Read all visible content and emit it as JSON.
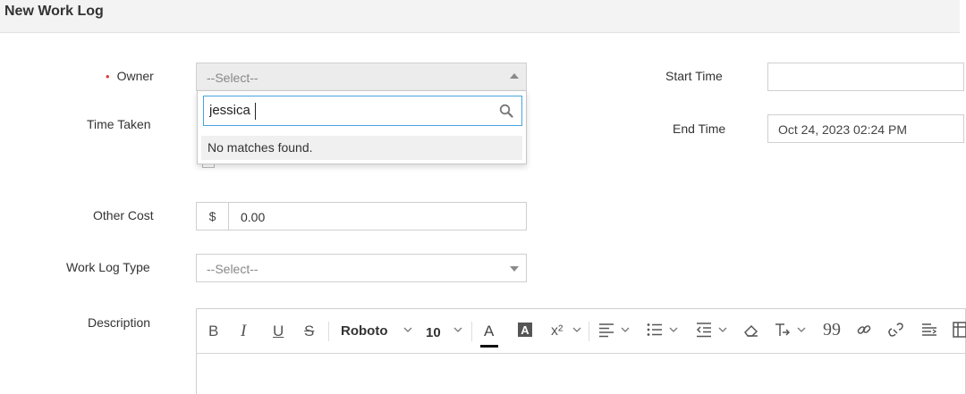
{
  "header": {
    "title": "New Work Log"
  },
  "form": {
    "owner": {
      "label": "Owner",
      "required_mark": "•",
      "placeholder": "--Select--"
    },
    "owner_dropdown": {
      "search_value": "jessica",
      "no_matches": "No matches found."
    },
    "time_taken": {
      "label": "Time Taken"
    },
    "other_cost": {
      "label": "Other Cost",
      "currency": "$",
      "value": "0.00"
    },
    "work_log_type": {
      "label": "Work Log Type",
      "placeholder": "--Select--"
    },
    "description": {
      "label": "Description"
    },
    "start_time": {
      "label": "Start Time",
      "value": ""
    },
    "end_time": {
      "label": "End Time",
      "value": "Oct 24, 2023 02:24 PM"
    }
  },
  "editor_toolbar": {
    "bold": "B",
    "italic": "I",
    "underline": "U",
    "strike": "S",
    "font_family": "Roboto",
    "font_size": "10",
    "font_color": "A",
    "superscript": "x²"
  },
  "icons": [
    "search-icon",
    "chevron-down-icon",
    "chevron-up-icon",
    "align-icon",
    "bullet-list-icon",
    "outdent-icon",
    "eraser-icon",
    "text-direction-icon",
    "quote-icon",
    "link-icon",
    "unlink-icon",
    "strikethrough-line-icon",
    "table-icon"
  ]
}
